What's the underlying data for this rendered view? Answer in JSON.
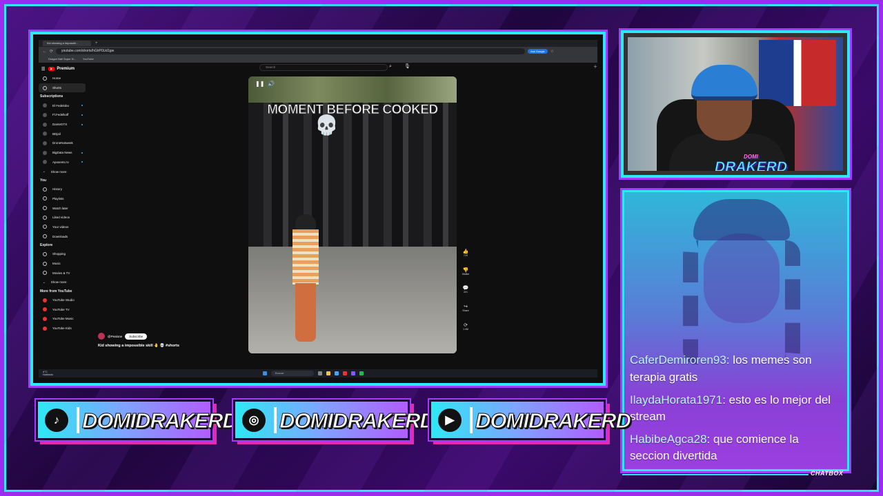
{
  "browser": {
    "tab_title": "Kid showing a impossib...",
    "new_tab_symbol": "+",
    "address": "youtube.com/shorts/hGlrP0Lkl1gw",
    "ask_google": "Ask Google",
    "bookmarks": [
      "Dragon Ball Super N...",
      "YouTube"
    ]
  },
  "youtube": {
    "logo_text": "Premium",
    "search_placeholder": "Search",
    "nav": [
      {
        "label": "Home"
      },
      {
        "label": "Shorts"
      }
    ],
    "subscriptions_heading": "Subscriptions",
    "subscriptions": [
      "El Fedelobo",
      "Fl.Fedelkoff",
      "DanteGTX",
      "BDjail",
      "DroneNotweek",
      "BigData News",
      "Aposento tv",
      "Show more"
    ],
    "you_heading": "You",
    "you_items": [
      "History",
      "Playlists",
      "Watch later",
      "Liked videos",
      "Your videos",
      "Downloads"
    ],
    "explore_heading": "Explore",
    "explore_items": [
      "Shopping",
      "Music",
      "Movies & TV",
      "Show more"
    ],
    "more_heading": "More from YouTube",
    "more_items": [
      "YouTube Studio",
      "YouTube TV",
      "YouTube Music",
      "YouTube Kids"
    ],
    "video": {
      "overlay_text": "MOMENT BEFORE COOKED",
      "skull": "💀",
      "channel": "@Pealone",
      "subscribe": "Subscribe",
      "title": "Kid showing a impossible skill 🤚 💀 #shorts",
      "actions": [
        {
          "icon": "like-icon",
          "glyph": "👍",
          "label": "71K"
        },
        {
          "icon": "dislike-icon",
          "glyph": "👎",
          "label": "Dislike"
        },
        {
          "icon": "comment-icon",
          "glyph": "💬",
          "label": "221"
        },
        {
          "icon": "share-icon",
          "glyph": "↪",
          "label": "Share"
        },
        {
          "icon": "remix-icon",
          "glyph": "⟳",
          "label": "1.4M"
        }
      ]
    }
  },
  "taskbar": {
    "weather": "4°C\nNublado",
    "search_placeholder": "Buscar"
  },
  "webcam": {
    "logo_small": "DOMI",
    "logo_big": "DRAKERD"
  },
  "chat": {
    "messages": [
      {
        "user": "CaferDemiroren93",
        "text": " los memes son terapia gratis"
      },
      {
        "user": "IlaydaHorata1971",
        "text": " esto es lo mejor del stream"
      },
      {
        "user": "HabibeAgca28",
        "text": " que comience la seccion divertida"
      }
    ],
    "label": "CHATBOX"
  },
  "socials": [
    {
      "platform": "tiktok",
      "glyph": "♪",
      "handle": "DOMIDRAKERD"
    },
    {
      "platform": "instagram",
      "glyph": "◎",
      "handle": "DOMIDRAKERD"
    },
    {
      "platform": "youtube",
      "glyph": "▶",
      "handle": "DOMIDRAKERD"
    }
  ],
  "colors": {
    "accent_cyan": "#2ee8f5",
    "accent_purple": "#a63bff",
    "accent_pink": "#e22bb2"
  }
}
